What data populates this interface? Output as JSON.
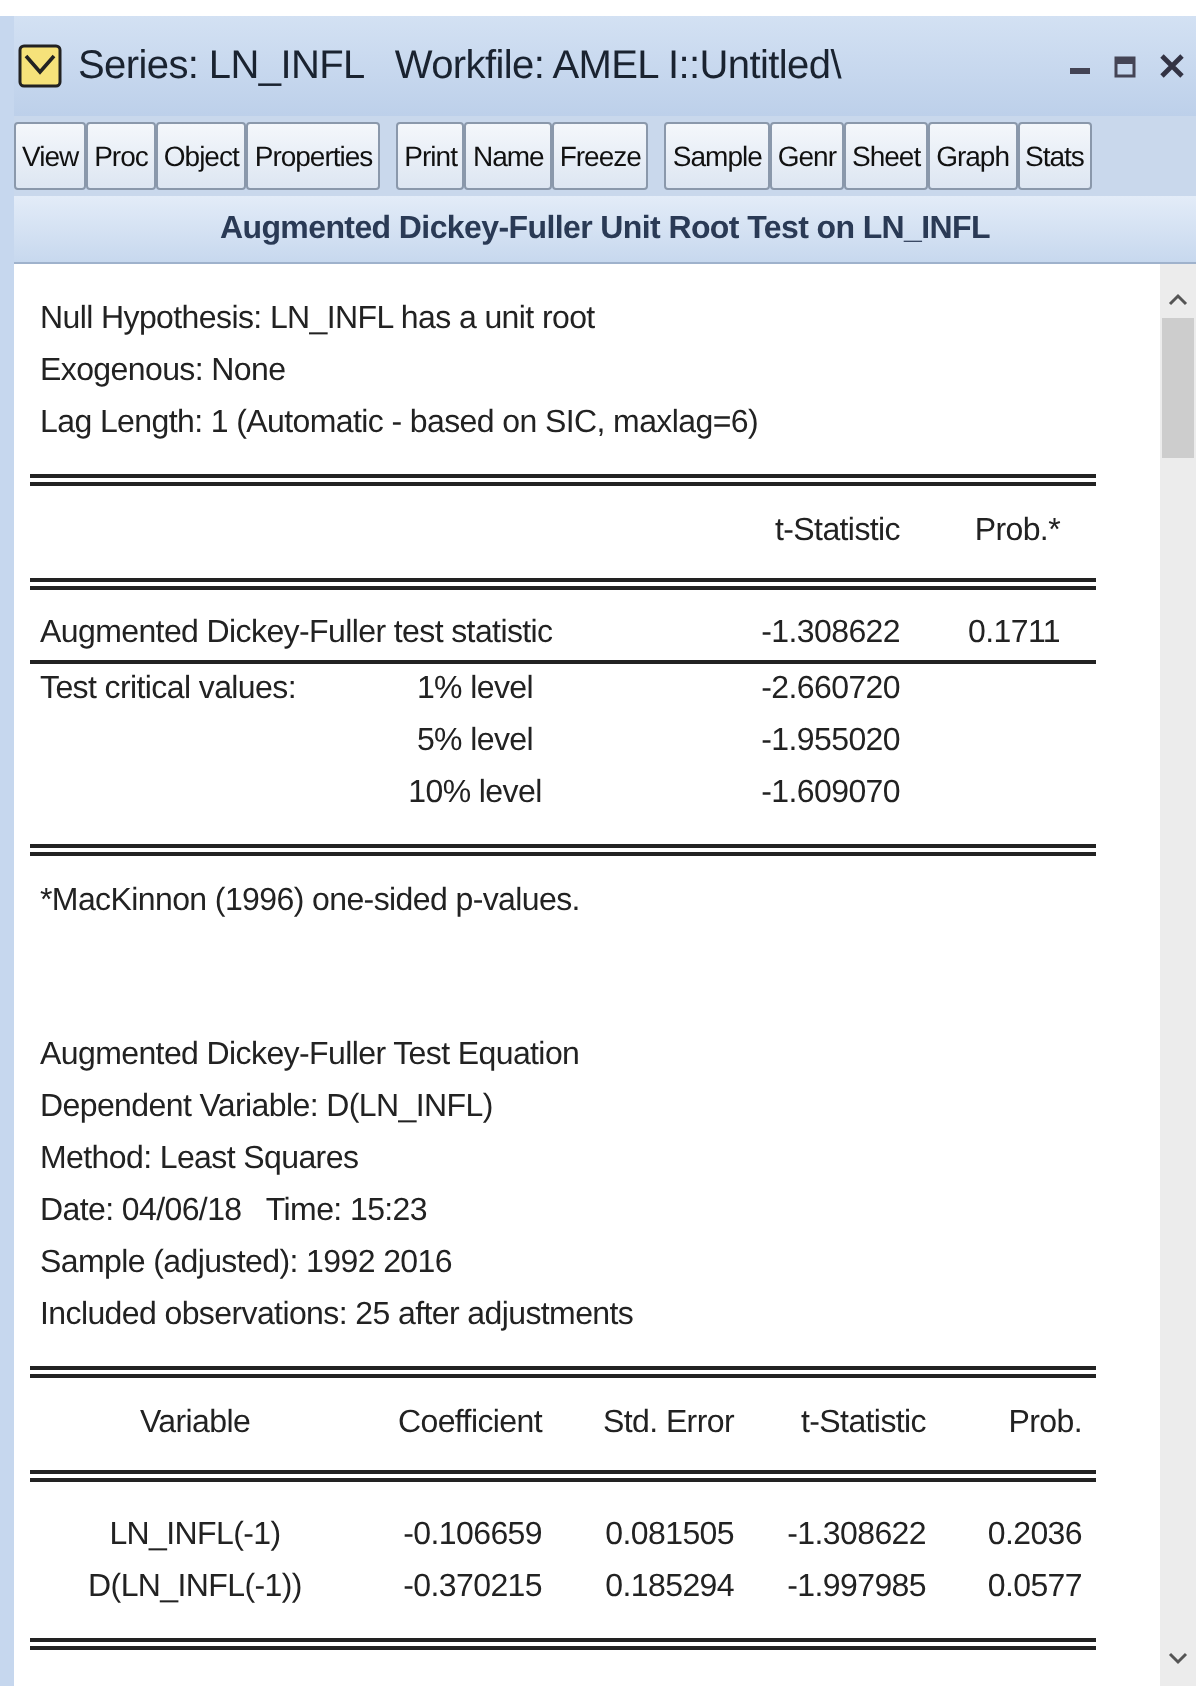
{
  "window": {
    "title": "Series: LN_INFL   Workfile: AMEL I::Untitled\\"
  },
  "toolbar": {
    "groups": [
      [
        "View",
        "Proc",
        "Object",
        "Properties"
      ],
      [
        "Print",
        "Name",
        "Freeze"
      ],
      [
        "Sample",
        "Genr",
        "Sheet",
        "Graph",
        "Stats"
      ]
    ]
  },
  "output": {
    "heading": "Augmented Dickey-Fuller Unit Root Test on LN_INFL",
    "test_info": [
      "Null Hypothesis: LN_INFL has a unit root",
      "Exogenous: None",
      "Lag Length: 1 (Automatic - based on SIC, maxlag=6)"
    ],
    "unit_root_table": {
      "columns": [
        "t-Statistic",
        "Prob.*"
      ],
      "rows": [
        {
          "kind": "statistic",
          "label": "Augmented Dickey-Fuller test statistic",
          "t_statistic": "-1.308622",
          "prob": "0.1711"
        },
        {
          "kind": "critical",
          "label": "Test critical values:",
          "level": "1% level",
          "t_statistic": "-2.660720"
        },
        {
          "kind": "critical",
          "level": "5% level",
          "t_statistic": "-1.955020"
        },
        {
          "kind": "critical",
          "level": "10% level",
          "t_statistic": "-1.609070"
        }
      ]
    },
    "footnote": "*MacKinnon (1996) one-sided p-values.",
    "equation_info": [
      "Augmented Dickey-Fuller Test Equation",
      "Dependent Variable: D(LN_INFL)",
      "Method: Least Squares",
      "Date: 04/06/18   Time: 15:23",
      "Sample (adjusted): 1992 2016",
      "Included observations: 25 after adjustments"
    ],
    "coefficient_table": {
      "columns": [
        "Variable",
        "Coefficient",
        "Std. Error",
        "t-Statistic",
        "Prob."
      ],
      "rows": [
        [
          "LN_INFL(-1)",
          "-0.106659",
          "0.081505",
          "-1.308622",
          "0.2036"
        ],
        [
          "D(LN_INFL(-1))",
          "-0.370215",
          "0.185294",
          "-1.997985",
          "0.0577"
        ]
      ]
    }
  }
}
